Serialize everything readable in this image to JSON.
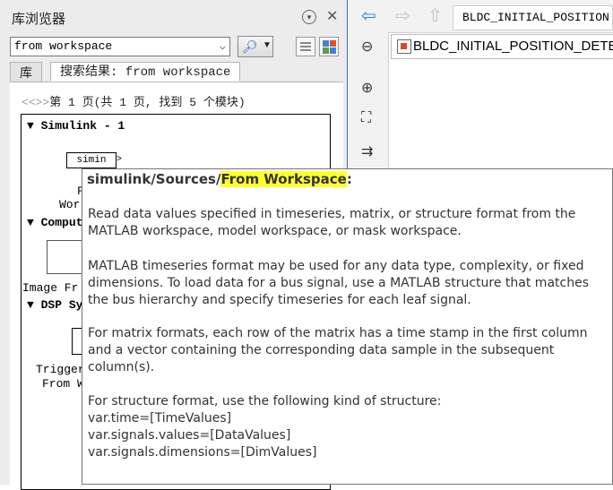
{
  "library_browser": {
    "title": "库浏览器",
    "search_value": "from workspace",
    "tabs": [
      "库",
      "搜索结果: from workspace"
    ],
    "pager": {
      "back_arrows": "<<",
      "fwd_arrows": ">>",
      "text": "第 1 页(共 1 页, 找到 5 个模块)"
    },
    "groups": [
      {
        "label": "Simulink - 1"
      },
      {
        "label": "Comput"
      },
      {
        "label": "DSP Sy"
      }
    ],
    "visible_fragments": {
      "simin_block": "simin",
      "frag_f": "F",
      "frag_wor": "Wor",
      "image_fr": "Image Fr",
      "trigger": "Trigger",
      "from_w": "From W"
    }
  },
  "model": {
    "breadcrumb": "BLDC_INITIAL_POSITION",
    "tab_label": "BLDC_INITIAL_POSITION_DETEC"
  },
  "tooltip": {
    "path_prefix": "simulink/Sources/",
    "path_highlight": "From Workspace",
    "path_suffix": ":",
    "paragraphs": [
      "Read data values specified in timeseries, matrix, or structure format from the MATLAB workspace, model workspace, or mask workspace.",
      "MATLAB timeseries format may be used for any data type, complexity, or fixed dimensions. To load data for a bus signal, use a MATLAB structure that matches the bus hierarchy and specify timeseries for each leaf signal.",
      "For matrix formats, each row of the matrix has a time stamp in the first column and a vector containing the corresponding data sample in the subsequent column(s)."
    ],
    "structure_lines": [
      "For structure format, use the following kind of structure:",
      "var.time=[TimeValues]",
      "var.signals.values=[DataValues]",
      "var.signals.dimensions=[DimValues]"
    ]
  },
  "colors": {
    "highlight": "#ffff33",
    "panel_border": "#3a6bc1",
    "nav_back": "#2f7fd6"
  }
}
